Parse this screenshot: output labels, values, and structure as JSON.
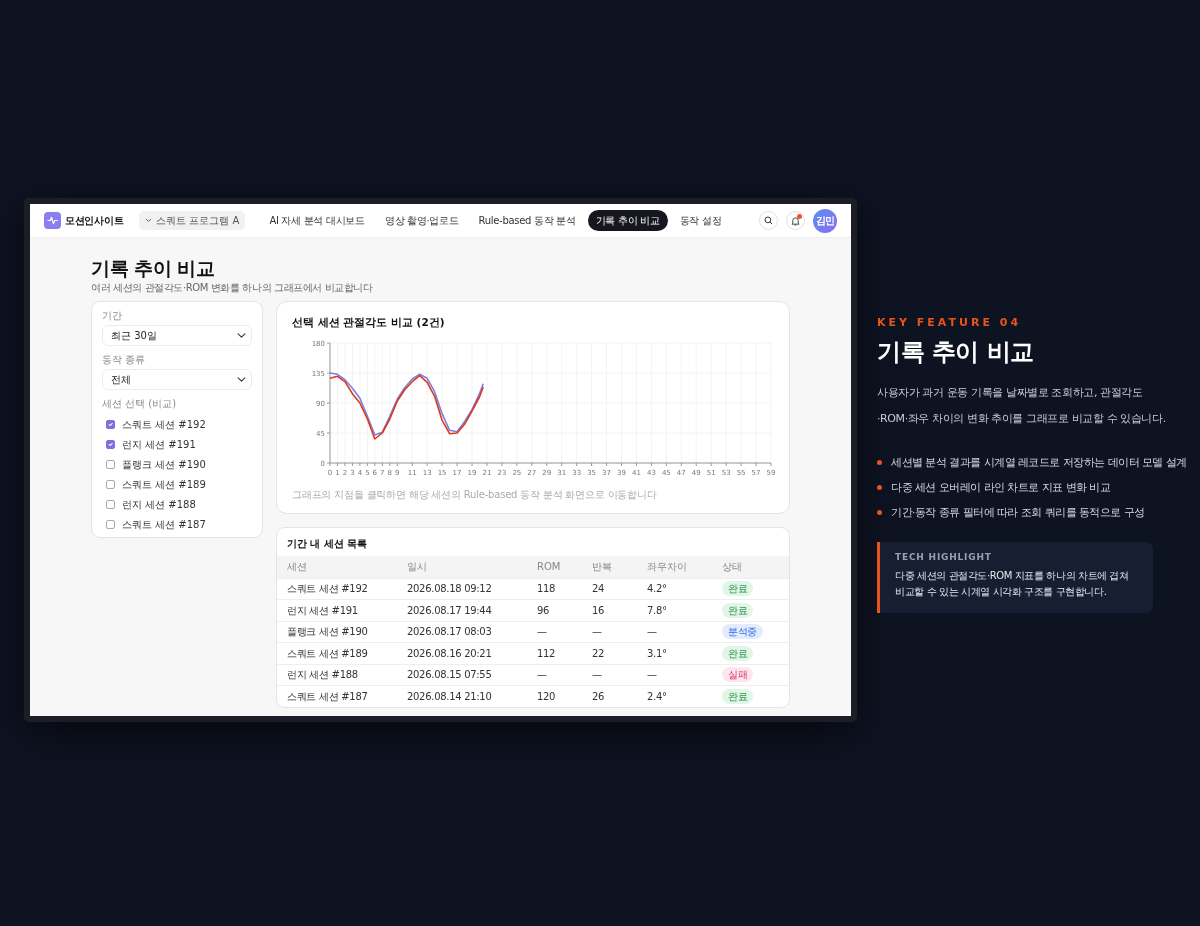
{
  "app": {
    "logo": "모션인사이트",
    "program": "스쿼트 프로그램 A",
    "avatar": "김민",
    "notification": true,
    "nav": [
      {
        "label": "AI 자세 분석 대시보드",
        "selected": false
      },
      {
        "label": "영상 촬영·업로드",
        "selected": false
      },
      {
        "label": "Rule-based 동작 분석",
        "selected": false
      },
      {
        "label": "기록 추이 비교",
        "selected": true
      },
      {
        "label": "동작 설정",
        "selected": false
      }
    ]
  },
  "page": {
    "title": "기록 추이 비교",
    "subtitle": "여러 세션의 관절각도·ROM 변화를 하나의 그래프에서 비교합니다"
  },
  "filters": {
    "period_label": "기간",
    "period": "최근 30일",
    "type_label": "동작 종류",
    "type": "전체",
    "sessions_label": "세션 선택 (비교)",
    "sessions": [
      {
        "label": "스쿼트 세션 #192",
        "checked": true
      },
      {
        "label": "런지 세션 #191",
        "checked": true
      },
      {
        "label": "플랭크 세션 #190",
        "checked": false
      },
      {
        "label": "스쿼트 세션 #189",
        "checked": false
      },
      {
        "label": "런지 세션 #188",
        "checked": false
      },
      {
        "label": "스쿼트 세션 #187",
        "checked": false
      }
    ]
  },
  "chart": {
    "title": "선택 세션 관절각도 비교 (2건)",
    "note": "그래프의 지점을 클릭하면 해당 세션의 Rule-based 동작 분석 화면으로 이동합니다",
    "chart_data": {
      "type": "line",
      "grid": true,
      "x": [
        0,
        1,
        2,
        3,
        4,
        5,
        6,
        7,
        8,
        9,
        10,
        11,
        12,
        13,
        14,
        15,
        16,
        17,
        18,
        19,
        20,
        20.5
      ],
      "xlim": [
        0,
        59
      ],
      "ylim": [
        0,
        180
      ],
      "xticks": [
        0,
        1,
        2,
        3,
        4,
        5,
        6,
        7,
        8,
        9,
        11,
        13,
        15,
        17,
        19,
        21,
        23,
        25,
        27,
        29,
        31,
        33,
        35,
        37,
        39,
        41,
        43,
        45,
        47,
        49,
        51,
        53,
        55,
        57,
        59
      ],
      "yticks": [
        0,
        45,
        90,
        135,
        180
      ],
      "series": [
        {
          "color": "#7b7fe6",
          "values": [
            135,
            133,
            125,
            112,
            97,
            70,
            42,
            46,
            70,
            96,
            113,
            126,
            133,
            127,
            107,
            74,
            49,
            47,
            62,
            80,
            104,
            119
          ]
        },
        {
          "color": "#d93a1a",
          "values": [
            127,
            130,
            122,
            104,
            90,
            66,
            36,
            45,
            66,
            93,
            110,
            122,
            131,
            121,
            100,
            64,
            44,
            45,
            58,
            78,
            99,
            114
          ]
        }
      ]
    }
  },
  "table": {
    "title": "기간 내 세션 목록",
    "columns": [
      "세션",
      "일시",
      "ROM",
      "반복",
      "좌우차이",
      "상태"
    ],
    "rows": [
      {
        "cells": [
          "스쿼트 세션 #192",
          "2026.08.18 09:12",
          "118",
          "24",
          "4.2°"
        ],
        "status": "완료",
        "kind": "done"
      },
      {
        "cells": [
          "런지 세션 #191",
          "2026.08.17 19:44",
          "96",
          "16",
          "7.8°"
        ],
        "status": "완료",
        "kind": "done"
      },
      {
        "cells": [
          "플랭크 세션 #190",
          "2026.08.17 08:03",
          "—",
          "—",
          "—"
        ],
        "status": "분석중",
        "kind": "progress"
      },
      {
        "cells": [
          "스쿼트 세션 #189",
          "2026.08.16 20:21",
          "112",
          "22",
          "3.1°"
        ],
        "status": "완료",
        "kind": "done"
      },
      {
        "cells": [
          "런지 세션 #188",
          "2026.08.15 07:55",
          "—",
          "—",
          "—"
        ],
        "status": "실패",
        "kind": "failed"
      },
      {
        "cells": [
          "스쿼트 세션 #187",
          "2026.08.14 21:10",
          "120",
          "26",
          "2.4°"
        ],
        "status": "완료",
        "kind": "done"
      }
    ]
  },
  "feature": {
    "eyebrow": "KEY FEATURE 04",
    "title": "기록 추이 비교",
    "description": "사용자가 과거 운동 기록을 날짜별로 조회하고, 관절각도·ROM·좌우 차이의 변화 추이를 그래프로 비교할 수 있습니다.",
    "bullets": [
      "세션별 분석 결과를 시계열 레코드로 저장하는 데이터 모델 설계",
      "다중 세션 오버레이 라인 차트로 지표 변화 비교",
      "기간·동작 종류 필터에 따라 조회 쿼리를 동적으로 구성"
    ],
    "highlight_label": "TECH HIGHLIGHT",
    "highlight_text": "다중 세션의 관절각도·ROM 지표를 하나의 차트에 겹쳐 비교할 수 있는 시계열 시각화 구조를 구현합니다."
  }
}
